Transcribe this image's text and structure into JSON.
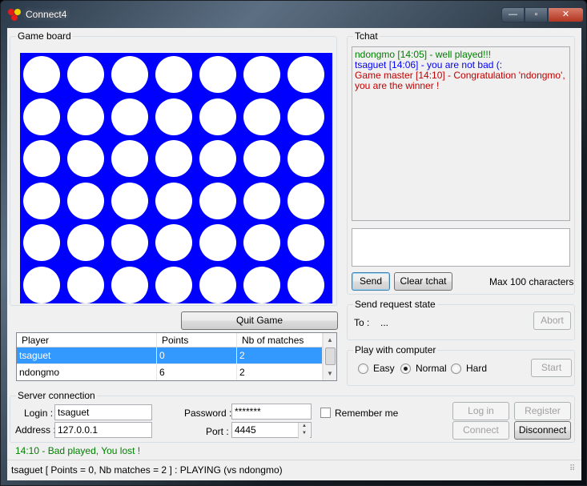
{
  "window": {
    "title": "Connect4",
    "buttons": {
      "minimize": "—",
      "maximize": "▫",
      "close": "✕"
    }
  },
  "game_board": {
    "legend": "Game board",
    "rows": 6,
    "cols": 7,
    "board_color": "#0000ff",
    "hole_color": "#ffffff",
    "quit_button": "Quit Game"
  },
  "players": {
    "columns": [
      "Player",
      "Points",
      "Nb of matches"
    ],
    "rows": [
      {
        "player": "tsaguet",
        "points": "0",
        "matches": "2",
        "selected": true
      },
      {
        "player": "ndongmo",
        "points": "6",
        "matches": "2",
        "selected": false
      }
    ]
  },
  "chat": {
    "legend": "Tchat",
    "messages": [
      {
        "text": "ndongmo [14:05] - well played!!!",
        "color": "#008000"
      },
      {
        "text": "tsaguet [14:06] - you are not bad (:",
        "color": "#0000ff"
      },
      {
        "text": "Game master [14:10] - Congratulation 'ndongmo', you are the winner !",
        "color": "#c00000"
      }
    ],
    "input_value": "",
    "send_button": "Send",
    "clear_button": "Clear tchat",
    "max_label": "Max 100 characters"
  },
  "request_state": {
    "legend": "Send request state",
    "to_label": "To :",
    "to_value": "...",
    "abort_button": "Abort"
  },
  "computer": {
    "legend": "Play with computer",
    "options": [
      "Easy",
      "Normal",
      "Hard"
    ],
    "selected": "Normal",
    "start_button": "Start"
  },
  "server": {
    "legend": "Server connection",
    "login_label": "Login :",
    "login_value": "tsaguet",
    "address_label": "Address :",
    "address_value": "127.0.0.1",
    "password_label": "Password :",
    "password_value": "*******",
    "port_label": "Port :",
    "port_value": "4445",
    "remember_label": "Remember me",
    "remember_checked": false,
    "login_button": "Log in",
    "register_button": "Register",
    "connect_button": "Connect",
    "disconnect_button": "Disconnect"
  },
  "status_message": "14:10 - Bad played, You lost !",
  "status_bar": "tsaguet [ Points = 0, Nb matches = 2 ] : PLAYING (vs ndongmo)"
}
